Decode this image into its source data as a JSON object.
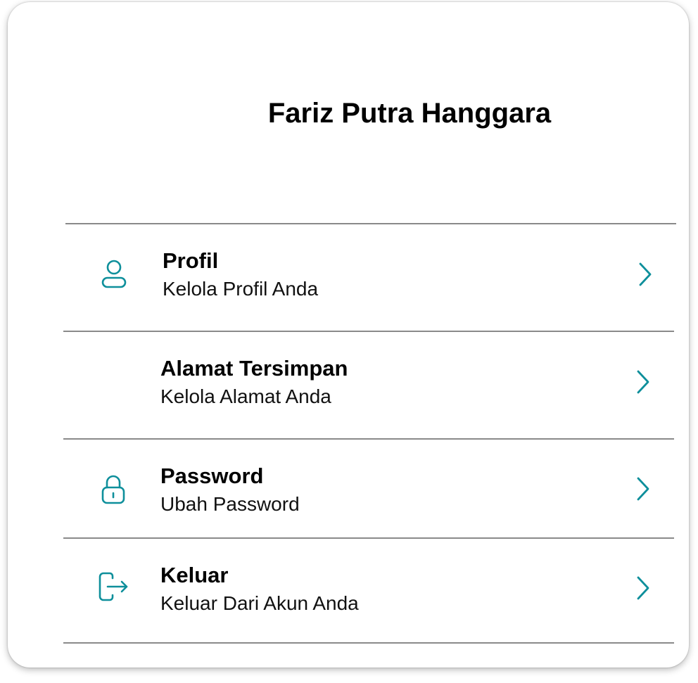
{
  "profile": {
    "name": "Fariz Putra Hanggara"
  },
  "colors": {
    "accent": "#0e8f9b",
    "divider": "#8a8a8a"
  },
  "menu": {
    "items": [
      {
        "title": "Profil",
        "subtitle": "Kelola Profil Anda",
        "icon": "user-icon"
      },
      {
        "title": "Alamat Tersimpan",
        "subtitle": "Kelola Alamat Anda",
        "icon": ""
      },
      {
        "title": "Password",
        "subtitle": "Ubah Password",
        "icon": "lock-icon"
      },
      {
        "title": "Keluar",
        "subtitle": "Keluar Dari Akun Anda",
        "icon": "logout-icon"
      }
    ]
  }
}
